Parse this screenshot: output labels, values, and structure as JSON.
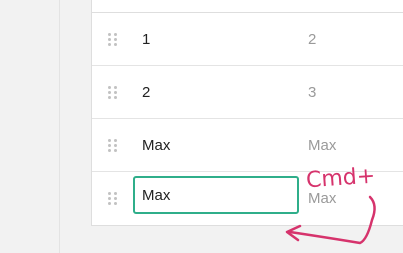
{
  "rows": [
    {
      "name": "1",
      "value": "2"
    },
    {
      "name": "2",
      "value": "3"
    },
    {
      "name": "Max",
      "value": "Max"
    },
    {
      "name": "Max",
      "value": "Max",
      "editing": true
    }
  ],
  "annotation": {
    "text": "Cmd+",
    "color": "#d6336c"
  }
}
